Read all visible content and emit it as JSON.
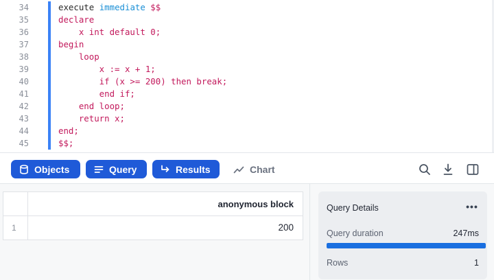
{
  "editor": {
    "line_numbers": [
      "34",
      "35",
      "36",
      "37",
      "38",
      "39",
      "40",
      "41",
      "42",
      "43",
      "44",
      "45"
    ],
    "code_lines": [
      [
        {
          "t": "execute ",
          "c": "plain"
        },
        {
          "t": "immediate",
          "c": "kw"
        },
        {
          "t": " $$",
          "c": "str"
        }
      ],
      [
        {
          "t": "declare",
          "c": "str"
        }
      ],
      [
        {
          "t": "    x int default 0;",
          "c": "str"
        }
      ],
      [
        {
          "t": "begin",
          "c": "str"
        }
      ],
      [
        {
          "t": "    loop",
          "c": "str"
        }
      ],
      [
        {
          "t": "        x := x + 1;",
          "c": "str"
        }
      ],
      [
        {
          "t": "        if (x >= 200) then break;",
          "c": "str"
        }
      ],
      [
        {
          "t": "        end if;",
          "c": "str"
        }
      ],
      [
        {
          "t": "    end loop;",
          "c": "str"
        }
      ],
      [
        {
          "t": "    return x;",
          "c": "str"
        }
      ],
      [
        {
          "t": "end;",
          "c": "str"
        }
      ],
      [
        {
          "t": "$$;",
          "c": "str"
        }
      ]
    ]
  },
  "toolbar": {
    "objects_label": "Objects",
    "query_label": "Query",
    "results_label": "Results",
    "chart_label": "Chart",
    "icons": [
      "search-icon",
      "download-icon",
      "split-panel-icon"
    ],
    "accent_color": "#1f5ad8"
  },
  "results": {
    "column_header": "anonymous block",
    "rows": [
      {
        "row_number": "1",
        "value": "200"
      }
    ]
  },
  "details": {
    "title": "Query Details",
    "more_label": "•••",
    "duration_label": "Query duration",
    "duration_value": "247ms",
    "duration_fraction": 1.0,
    "rows_label": "Rows",
    "rows_value": "1"
  }
}
